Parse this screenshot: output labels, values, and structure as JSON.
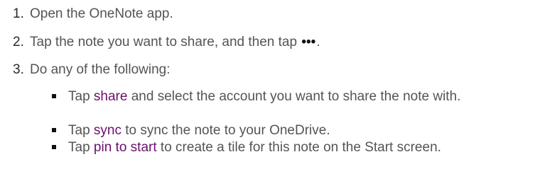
{
  "steps": [
    {
      "num": "1.",
      "text": "Open the OneNote app."
    },
    {
      "num": "2.",
      "text_before": "Tap the note you want to share, and then tap",
      "glyph": "•••",
      "text_after": "."
    },
    {
      "num": "3.",
      "text": "Do any of the following:"
    }
  ],
  "bullets": [
    {
      "prefix": "Tap",
      "keyword": "share",
      "suffix": "and select the account you want to share the note with."
    },
    {
      "prefix": "Tap",
      "keyword": "sync",
      "suffix": "to sync the note to your OneDrive."
    },
    {
      "prefix": "Tap",
      "keyword": "pin to start",
      "suffix": "to create a tile for this note on the Start screen."
    }
  ],
  "colors": {
    "text": "#545454",
    "keyword": "#6a0f6d",
    "number": "#2a2a2a"
  }
}
